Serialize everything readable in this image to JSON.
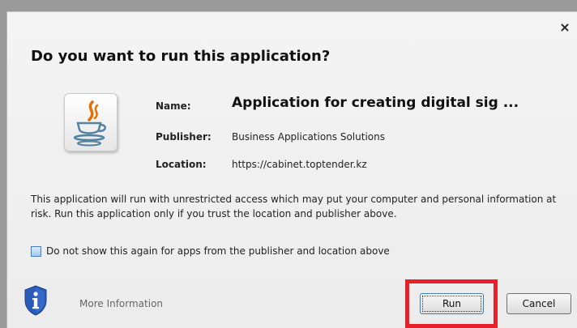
{
  "dialog": {
    "title": "Do you want to run this application?",
    "close_label": "×"
  },
  "info": {
    "name_label": "Name:",
    "name_value": "Application for creating digital sig ...",
    "publisher_label": "Publisher:",
    "publisher_value": "Business Applications Solutions",
    "location_label": "Location:",
    "location_value": "https://cabinet.toptender.kz"
  },
  "warning": {
    "text": "This application will run with unrestricted access which may put your computer and personal information at risk. Run this application only if you trust the location and publisher above."
  },
  "checkbox": {
    "label": "Do not show this again for apps from the publisher and location above",
    "checked": false
  },
  "footer": {
    "more_info_label": "More Information",
    "run_label": "Run",
    "cancel_label": "Cancel"
  },
  "icons": {
    "app": "java-icon",
    "info": "shield-info-icon"
  },
  "colors": {
    "highlight": "#e8202a",
    "java_blue": "#5382a1",
    "java_orange": "#e76f00",
    "shield_blue": "#2a5bb8"
  }
}
